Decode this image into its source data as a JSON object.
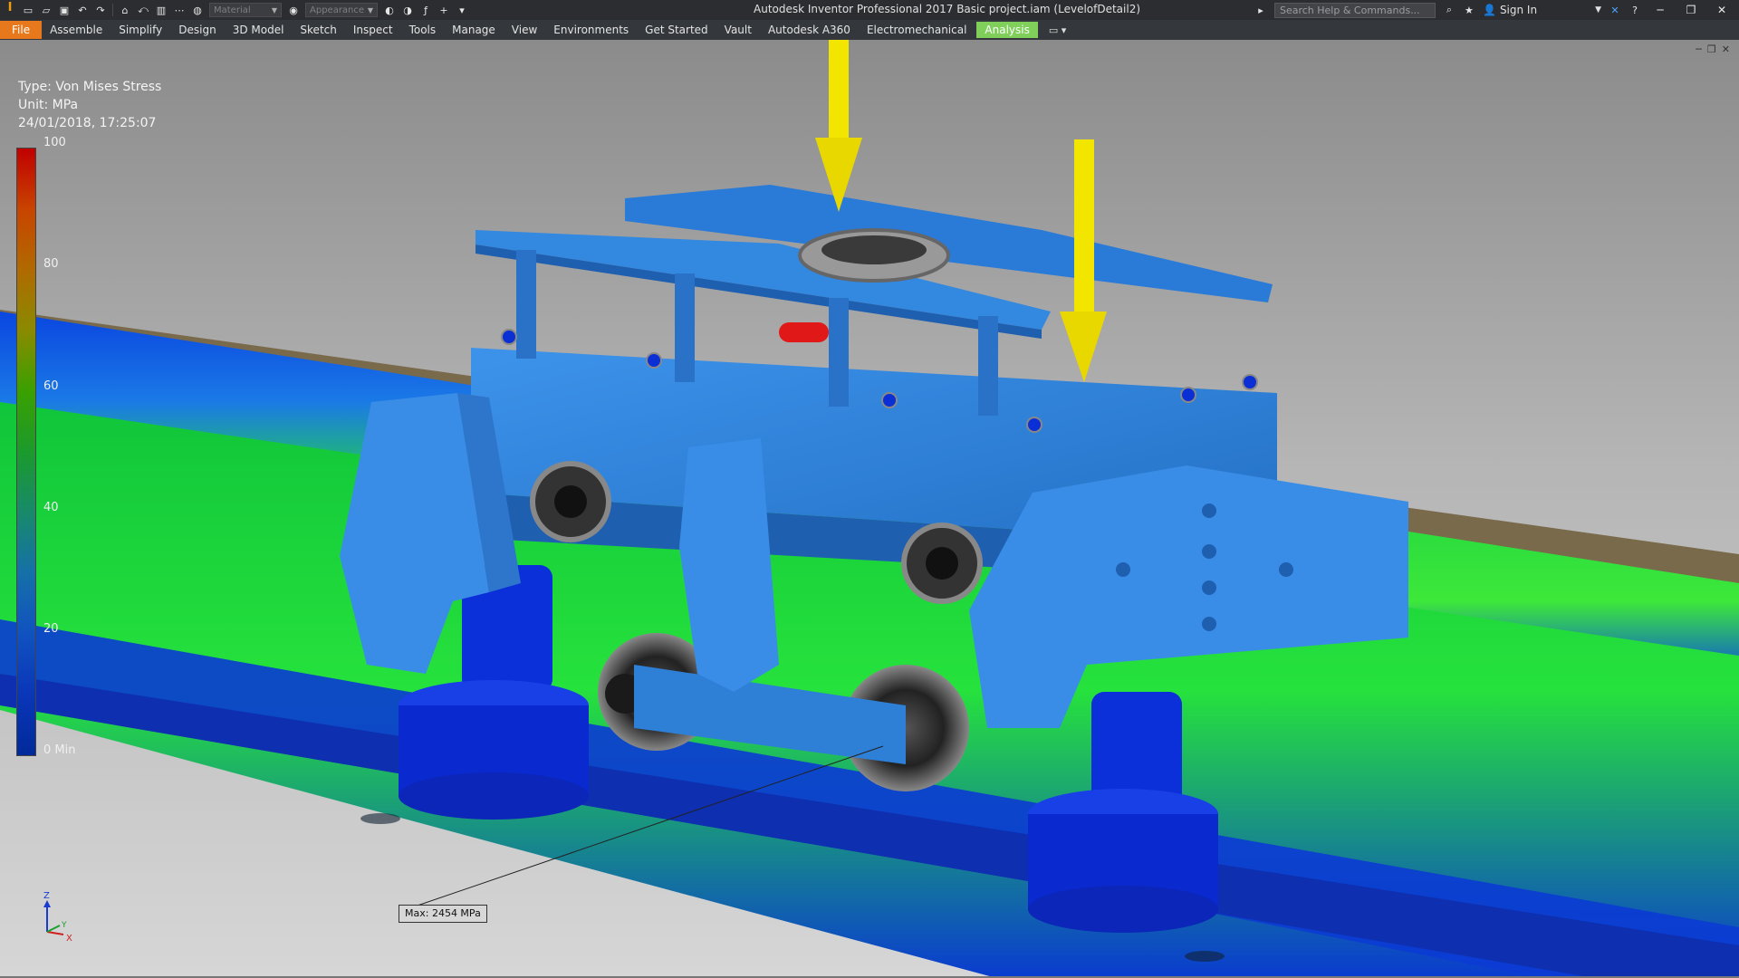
{
  "window": {
    "title": "Autodesk Inventor Professional 2017    Basic project.iam (LevelofDetail2)",
    "search_placeholder": "Search Help & Commands...",
    "sign_in": "Sign In"
  },
  "qat": {
    "material": "Material",
    "appearance": "Appearance"
  },
  "ribbon": {
    "tabs": [
      "File",
      "Assemble",
      "Simplify",
      "Design",
      "3D Model",
      "Sketch",
      "Inspect",
      "Tools",
      "Manage",
      "View",
      "Environments",
      "Get Started",
      "Vault",
      "Autodesk A360",
      "Electromechanical",
      "Analysis"
    ],
    "active_tab": "Analysis"
  },
  "result_info": {
    "type": "Type: Von Mises Stress",
    "unit": "Unit: MPa",
    "timestamp": "24/01/2018, 17:25:07"
  },
  "legend": {
    "labels": [
      "100",
      "80",
      "60",
      "40",
      "20",
      "0 Min"
    ],
    "max": 100,
    "min": 0
  },
  "probe": {
    "max_label": "Max: 2454 MPa"
  },
  "colors": {
    "accent_file": "#e8781c",
    "active_tab": "#7fcf5a",
    "part_blue": "#2e86e0",
    "load_arrow": "#f2e600"
  }
}
